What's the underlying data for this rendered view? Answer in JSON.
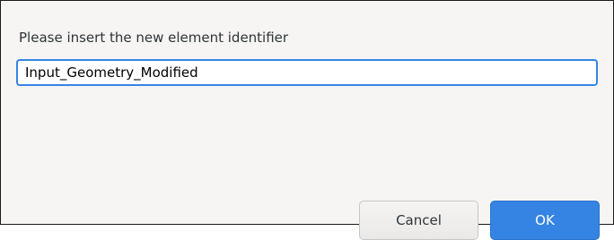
{
  "dialog": {
    "prompt": "Please insert the new element identifier",
    "input_value": "Input_Geometry_Modified",
    "cancel_label": "Cancel",
    "ok_label": "OK"
  },
  "colors": {
    "accent": "#3584e4",
    "background": "#f6f5f4"
  }
}
